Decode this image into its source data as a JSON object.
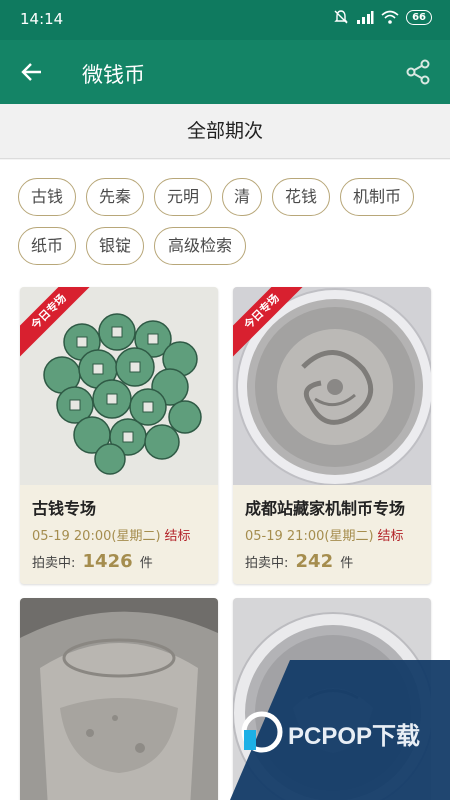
{
  "status_bar": {
    "time": "14:14",
    "battery": "66"
  },
  "app_bar": {
    "title": "微钱币"
  },
  "period": {
    "label": "全部期次"
  },
  "filters": [
    "古钱",
    "先秦",
    "元明",
    "清",
    "花钱",
    "机制币",
    "纸币",
    "银锭",
    "高级检索"
  ],
  "cards": [
    {
      "ribbon": "今日专场",
      "title": "古钱专场",
      "time": "05-19 20:00(星期二)",
      "status": "结标",
      "count_label": "拍卖中:",
      "count": "1426",
      "count_unit": "件"
    },
    {
      "ribbon": "今日专场",
      "title": "成都站藏家机制币专场",
      "time": "05-19 21:00(星期二)",
      "status": "结标",
      "count_label": "拍卖中:",
      "count": "242",
      "count_unit": "件"
    }
  ],
  "watermark": {
    "text": "PCPOP下载"
  },
  "colors": {
    "primary": "#148466",
    "status_bar": "#0f7a5f",
    "gold": "#a58d4e",
    "chip_border": "#b8a779",
    "ribbon": "#d8202f",
    "status_red": "#b3242a"
  }
}
